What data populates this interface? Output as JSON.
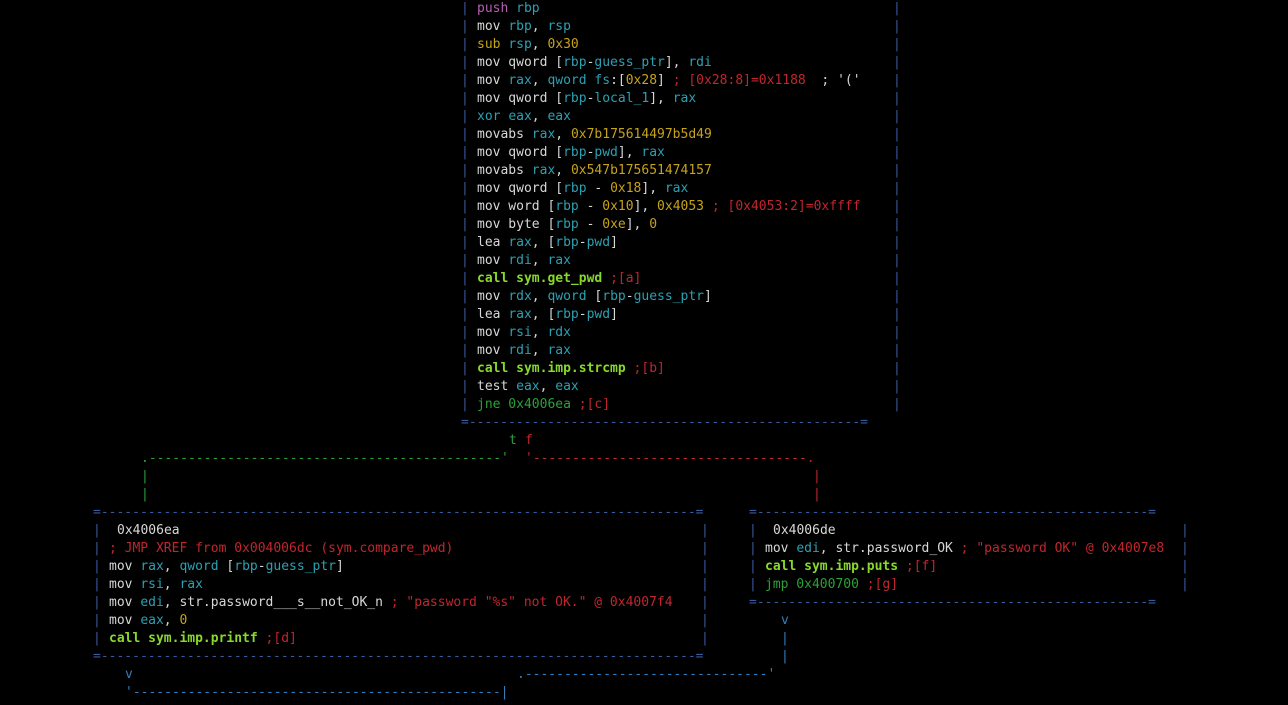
{
  "colors": {
    "mnemonic": "#d7d7d7",
    "register": "#2aa1b3",
    "number": "#c6a21b",
    "comment": "#c0262d",
    "call": "#87d92b",
    "push": "#b65fb2",
    "jump": "#2aa138",
    "header": "#d7d7d7"
  },
  "top_block": {
    "lines": [
      [
        {
          "t": "push",
          "c": "push"
        },
        {
          "t": " "
        },
        {
          "t": "rbp",
          "c": "register"
        }
      ],
      [
        {
          "t": "mov "
        },
        {
          "t": "rbp",
          "c": "register"
        },
        {
          "t": ", "
        },
        {
          "t": "rsp",
          "c": "register"
        }
      ],
      [
        {
          "t": "sub",
          "c": "number"
        },
        {
          "t": " "
        },
        {
          "t": "rsp",
          "c": "register"
        },
        {
          "t": ", "
        },
        {
          "t": "0x30",
          "c": "number"
        }
      ],
      [
        {
          "t": "mov qword ["
        },
        {
          "t": "rbp",
          "c": "register"
        },
        {
          "t": "-"
        },
        {
          "t": "guess_ptr",
          "c": "register"
        },
        {
          "t": "], "
        },
        {
          "t": "rdi",
          "c": "register"
        }
      ],
      [
        {
          "t": "mov "
        },
        {
          "t": "rax",
          "c": "register"
        },
        {
          "t": ", "
        },
        {
          "t": "qword fs",
          "c": "register"
        },
        {
          "t": ":["
        },
        {
          "t": "0x28",
          "c": "number"
        },
        {
          "t": "] "
        },
        {
          "t": "; [0x28:8]=0x1188",
          "c": "comment"
        },
        {
          "t": "  ; '('"
        }
      ],
      [
        {
          "t": "mov qword ["
        },
        {
          "t": "rbp",
          "c": "register"
        },
        {
          "t": "-"
        },
        {
          "t": "local_1",
          "c": "register"
        },
        {
          "t": "], "
        },
        {
          "t": "rax",
          "c": "register"
        }
      ],
      [
        {
          "t": "xor",
          "c": "register"
        },
        {
          "t": " "
        },
        {
          "t": "eax",
          "c": "register"
        },
        {
          "t": ", "
        },
        {
          "t": "eax",
          "c": "register"
        }
      ],
      [
        {
          "t": "movabs "
        },
        {
          "t": "rax",
          "c": "register"
        },
        {
          "t": ", "
        },
        {
          "t": "0x7b175614497b5d49",
          "c": "number"
        }
      ],
      [
        {
          "t": "mov qword ["
        },
        {
          "t": "rbp",
          "c": "register"
        },
        {
          "t": "-"
        },
        {
          "t": "pwd",
          "c": "register"
        },
        {
          "t": "], "
        },
        {
          "t": "rax",
          "c": "register"
        }
      ],
      [
        {
          "t": "movabs "
        },
        {
          "t": "rax",
          "c": "register"
        },
        {
          "t": ", "
        },
        {
          "t": "0x547b175651474157",
          "c": "number"
        }
      ],
      [
        {
          "t": "mov qword ["
        },
        {
          "t": "rbp",
          "c": "register"
        },
        {
          "t": " - "
        },
        {
          "t": "0x18",
          "c": "number"
        },
        {
          "t": "], "
        },
        {
          "t": "rax",
          "c": "register"
        }
      ],
      [
        {
          "t": "mov word ["
        },
        {
          "t": "rbp",
          "c": "register"
        },
        {
          "t": " - "
        },
        {
          "t": "0x10",
          "c": "number"
        },
        {
          "t": "], "
        },
        {
          "t": "0x4053",
          "c": "number"
        },
        {
          "t": " "
        },
        {
          "t": "; [0x4053:2]=0xffff",
          "c": "comment"
        }
      ],
      [
        {
          "t": "mov byte ["
        },
        {
          "t": "rbp",
          "c": "register"
        },
        {
          "t": " - "
        },
        {
          "t": "0xe",
          "c": "number"
        },
        {
          "t": "], "
        },
        {
          "t": "0",
          "c": "number"
        }
      ],
      [
        {
          "t": "lea "
        },
        {
          "t": "rax",
          "c": "register"
        },
        {
          "t": ", ["
        },
        {
          "t": "rbp",
          "c": "register"
        },
        {
          "t": "-"
        },
        {
          "t": "pwd",
          "c": "register"
        },
        {
          "t": "]"
        }
      ],
      [
        {
          "t": "mov "
        },
        {
          "t": "rdi",
          "c": "register"
        },
        {
          "t": ", "
        },
        {
          "t": "rax",
          "c": "register"
        }
      ],
      [
        {
          "t": "call sym.get_pwd",
          "c": "call"
        },
        {
          "t": " "
        },
        {
          "t": ";[a]",
          "c": "comment"
        }
      ],
      [
        {
          "t": "mov "
        },
        {
          "t": "rdx",
          "c": "register"
        },
        {
          "t": ", "
        },
        {
          "t": "qword",
          "c": "register"
        },
        {
          "t": " ["
        },
        {
          "t": "rbp",
          "c": "register"
        },
        {
          "t": "-"
        },
        {
          "t": "guess_ptr",
          "c": "register"
        },
        {
          "t": "]"
        }
      ],
      [
        {
          "t": "lea "
        },
        {
          "t": "rax",
          "c": "register"
        },
        {
          "t": ", ["
        },
        {
          "t": "rbp",
          "c": "register"
        },
        {
          "t": "-"
        },
        {
          "t": "pwd",
          "c": "register"
        },
        {
          "t": "]"
        }
      ],
      [
        {
          "t": "mov "
        },
        {
          "t": "rsi",
          "c": "register"
        },
        {
          "t": ", "
        },
        {
          "t": "rdx",
          "c": "register"
        }
      ],
      [
        {
          "t": "mov "
        },
        {
          "t": "rdi",
          "c": "register"
        },
        {
          "t": ", "
        },
        {
          "t": "rax",
          "c": "register"
        }
      ],
      [
        {
          "t": "call sym.imp.strcmp",
          "c": "call"
        },
        {
          "t": " "
        },
        {
          "t": ";[b]",
          "c": "comment"
        }
      ],
      [
        {
          "t": "test "
        },
        {
          "t": "eax",
          "c": "register"
        },
        {
          "t": ", "
        },
        {
          "t": "eax",
          "c": "register"
        }
      ],
      [
        {
          "t": "jne 0x4006ea",
          "c": "jump"
        },
        {
          "t": " "
        },
        {
          "t": ";[c]",
          "c": "comment"
        }
      ]
    ]
  },
  "branch_labels": {
    "true": "t",
    "false": "f"
  },
  "left_block": {
    "address": "0x4006ea",
    "lines": [
      [
        {
          "t": "; JMP XREF from 0x004006dc (sym.compare_pwd)",
          "c": "comment"
        }
      ],
      [
        {
          "t": "mov "
        },
        {
          "t": "rax",
          "c": "register"
        },
        {
          "t": ", "
        },
        {
          "t": "qword",
          "c": "register"
        },
        {
          "t": " ["
        },
        {
          "t": "rbp",
          "c": "register"
        },
        {
          "t": "-"
        },
        {
          "t": "guess_ptr",
          "c": "register"
        },
        {
          "t": "]"
        }
      ],
      [
        {
          "t": "mov "
        },
        {
          "t": "rsi",
          "c": "register"
        },
        {
          "t": ", "
        },
        {
          "t": "rax",
          "c": "register"
        }
      ],
      [
        {
          "t": "mov "
        },
        {
          "t": "edi",
          "c": "register"
        },
        {
          "t": ", "
        },
        {
          "t": "str.password___s__not_OK_n"
        },
        {
          "t": " ; \"password \"%s\" not OK.\" @ 0x4007f4",
          "c": "comment"
        }
      ],
      [
        {
          "t": "mov "
        },
        {
          "t": "eax",
          "c": "register"
        },
        {
          "t": ", "
        },
        {
          "t": "0",
          "c": "number"
        }
      ],
      [
        {
          "t": "call sym.imp.printf",
          "c": "call"
        },
        {
          "t": " "
        },
        {
          "t": ";[d]",
          "c": "comment"
        }
      ]
    ]
  },
  "right_block": {
    "address": "0x4006de",
    "lines": [
      [
        {
          "t": "mov "
        },
        {
          "t": "edi",
          "c": "register"
        },
        {
          "t": ", "
        },
        {
          "t": "str.password_OK"
        },
        {
          "t": " ; \"password OK\" @ 0x4007e8",
          "c": "comment"
        }
      ],
      [
        {
          "t": "call sym.imp.puts",
          "c": "call"
        },
        {
          "t": " "
        },
        {
          "t": ";[f]",
          "c": "comment"
        }
      ],
      [
        {
          "t": "jmp 0x400700",
          "c": "jump"
        },
        {
          "t": " "
        },
        {
          "t": ";[g]",
          "c": "comment"
        }
      ]
    ]
  }
}
